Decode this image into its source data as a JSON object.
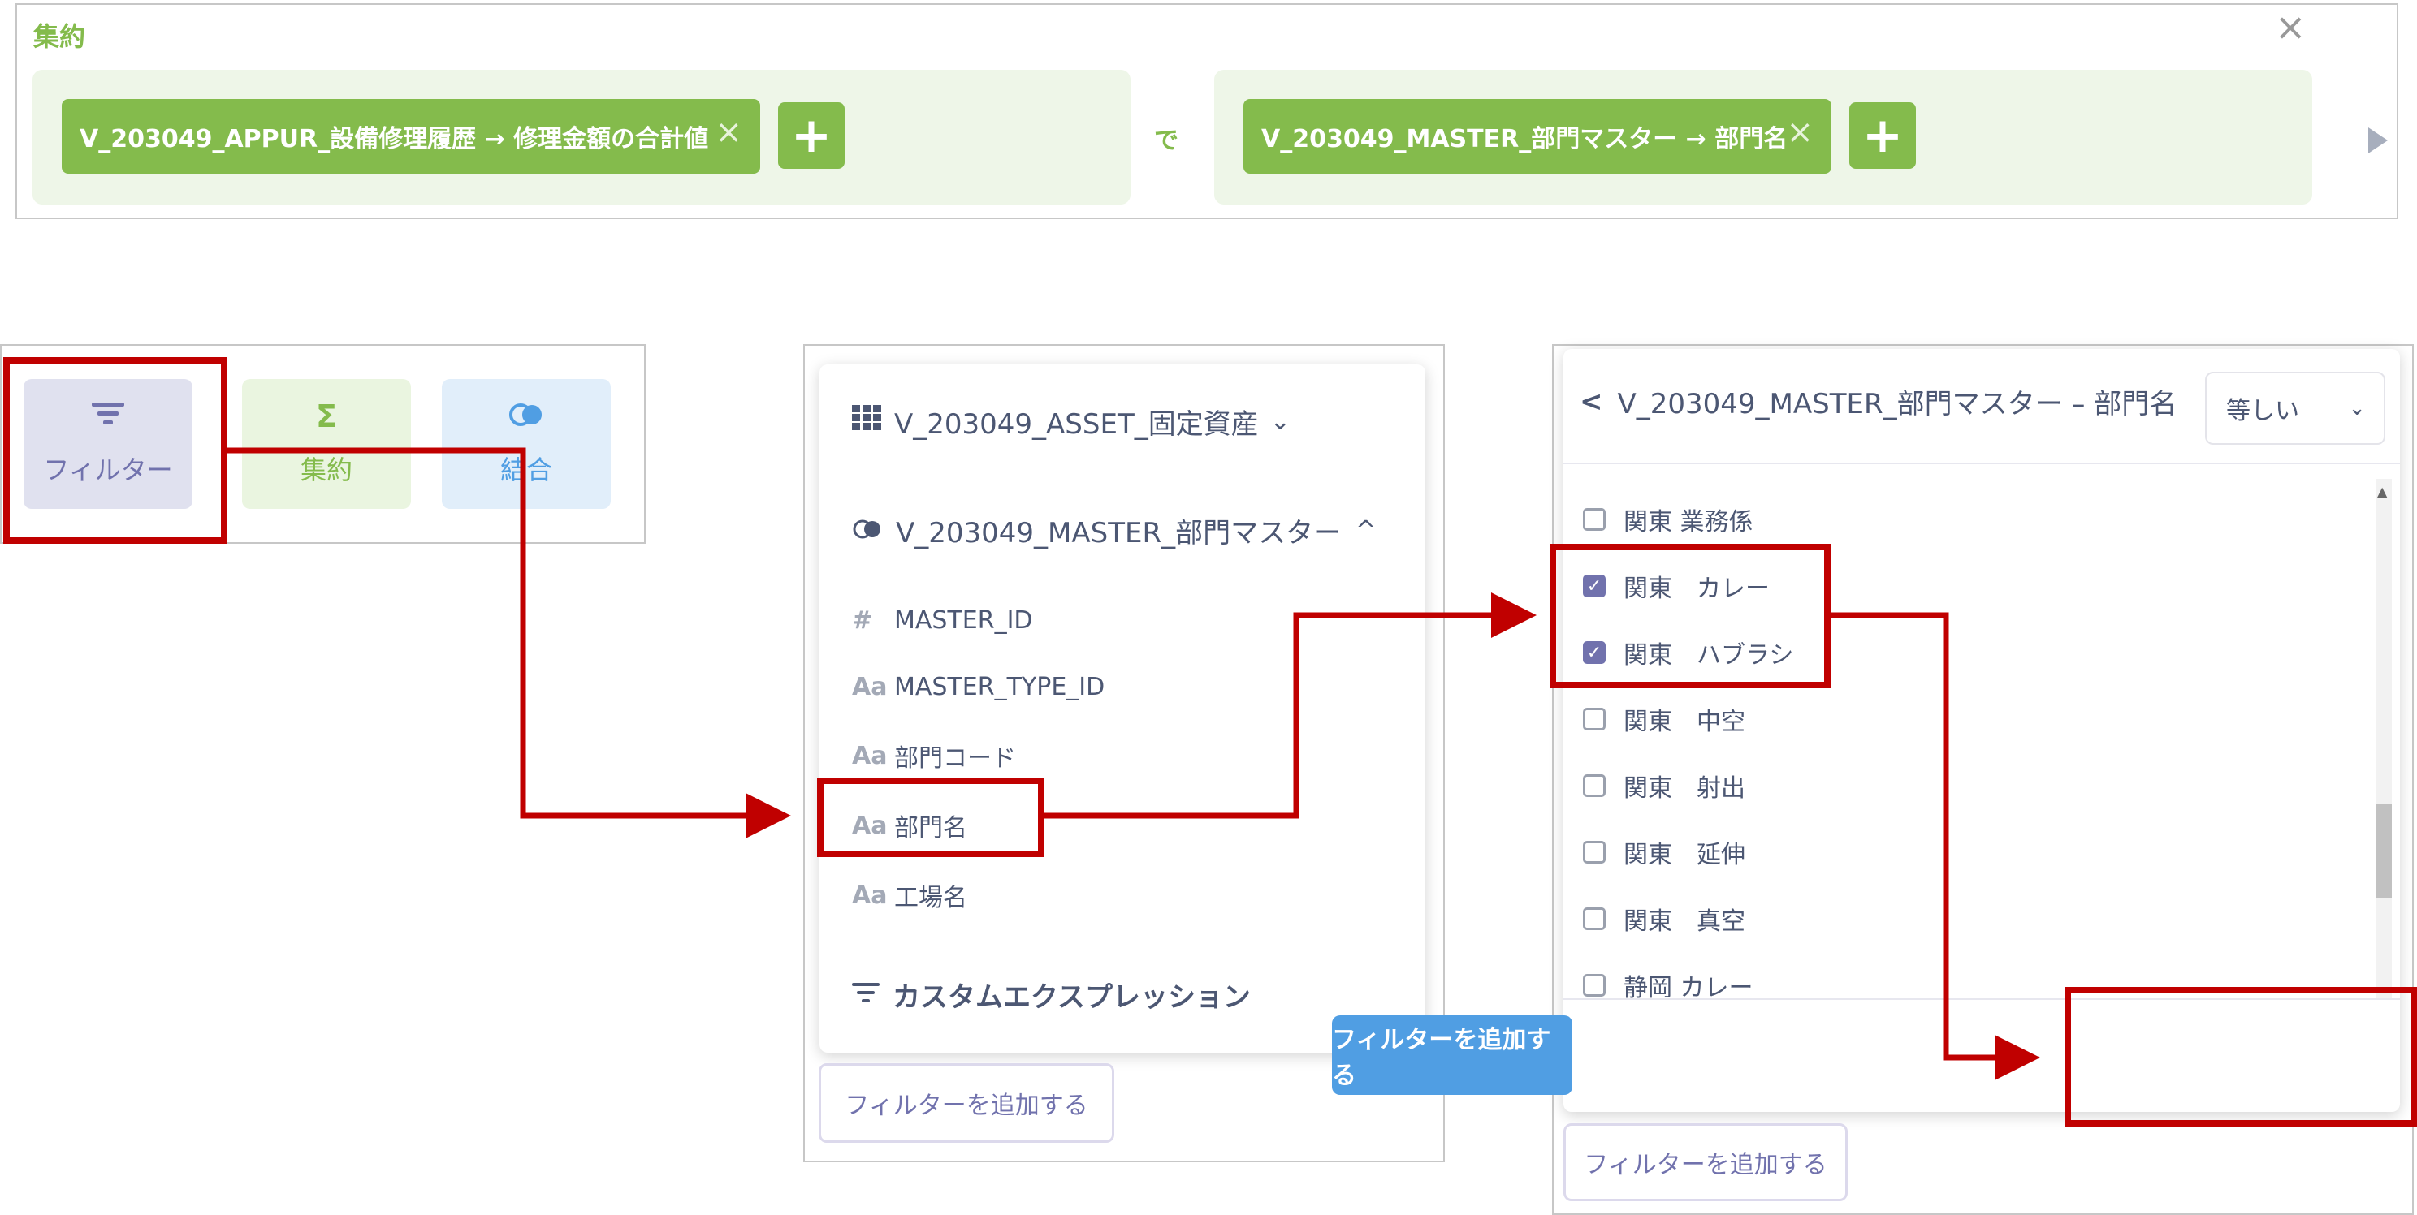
{
  "summarize": {
    "title": "集約",
    "close_icon": "×",
    "metric_pill": "V_203049_APPUR_設備修理履歴 → 修理金額の合計値",
    "by_label": "で",
    "group_pill": "V_203049_MASTER_部門マスター → 部門名",
    "remove_icon": "×",
    "add_icon": "+",
    "run_icon": "play-icon"
  },
  "actions": {
    "filter": {
      "label": "フィルター",
      "icon": "filter-icon"
    },
    "summarize": {
      "label": "集約",
      "icon": "Σ"
    },
    "join": {
      "label": "結合",
      "icon": "join-icon"
    }
  },
  "column_picker": {
    "tables": [
      {
        "name": "V_203049_ASSET_固定資産",
        "chevron": "⌄",
        "icon": "table-icon"
      },
      {
        "name": "V_203049_MASTER_部門マスター",
        "chevron": "^",
        "icon": "join-icon"
      }
    ],
    "columns": [
      {
        "type": "#",
        "name": "MASTER_ID"
      },
      {
        "type": "Aa",
        "name": "MASTER_TYPE_ID"
      },
      {
        "type": "Aa",
        "name": "部門コード"
      },
      {
        "type": "Aa",
        "name": "部門名"
      },
      {
        "type": "Aa",
        "name": "工場名"
      }
    ],
    "custom_expression": "カスタムエクスプレッション",
    "add_filter_button": "フィルターを追加する"
  },
  "filter_values": {
    "back_icon": "<",
    "header": "V_203049_MASTER_部門マスター – 部門名",
    "operator": "等しい",
    "operator_chevron": "⌄",
    "values": [
      {
        "label": "関東 業務係",
        "checked": false
      },
      {
        "label": "関東　カレー",
        "checked": true
      },
      {
        "label": "関東　ハブラシ",
        "checked": true
      },
      {
        "label": "関東　中空",
        "checked": false
      },
      {
        "label": "関東　射出",
        "checked": false
      },
      {
        "label": "関東　延伸",
        "checked": false
      },
      {
        "label": "関東　真空",
        "checked": false
      },
      {
        "label": "静岡 カレー",
        "checked": false
      }
    ],
    "add_button": "フィルターを追加する",
    "add_filter_button": "フィルターを追加する"
  },
  "colors": {
    "summarize_green": "#84bb4c",
    "filter_purple": "#7172ad",
    "join_blue": "#509ee3",
    "annotation_red": "#c00000"
  }
}
